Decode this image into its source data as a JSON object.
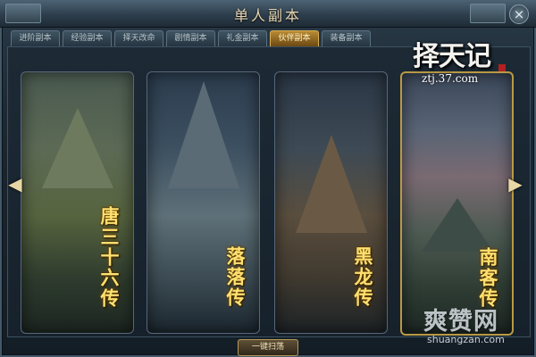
{
  "window": {
    "title": "单人副本",
    "close_symbol": "×"
  },
  "tabs": [
    {
      "label": "进阶副本",
      "active": false
    },
    {
      "label": "经验副本",
      "active": false
    },
    {
      "label": "择天改命",
      "active": false
    },
    {
      "label": "剧情副本",
      "active": false
    },
    {
      "label": "礼金副本",
      "active": false
    },
    {
      "label": "伙伴副本",
      "active": true
    },
    {
      "label": "装备副本",
      "active": false
    }
  ],
  "cards": [
    {
      "name": "唐三十六传",
      "selected": false
    },
    {
      "name": "落落传",
      "selected": false
    },
    {
      "name": "黑龙传",
      "selected": false
    },
    {
      "name": "南客传",
      "selected": true
    }
  ],
  "nav": {
    "prev_icon": "chevron-left-icon",
    "next_icon": "chevron-right-icon"
  },
  "actions": {
    "sweep_label": "一键扫荡"
  },
  "overlay": {
    "logo_text": "择天记",
    "logo_url": "ztj.37.com",
    "watermark_text": "爽赞网",
    "watermark_url": "shuangzan.com"
  },
  "colors": {
    "active_tab": "#b98b34",
    "card_title": "#ffe070",
    "selected_border": "#b89a45"
  }
}
